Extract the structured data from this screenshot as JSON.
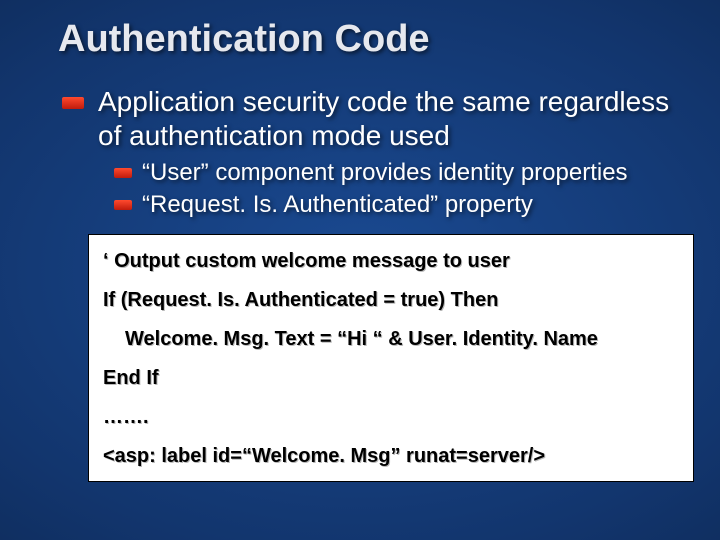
{
  "title": "Authentication Code",
  "main_bullet": "Application security code the same regardless of authentication mode used",
  "sub_bullets": [
    "“User” component provides identity properties",
    "“Request. Is. Authenticated” property"
  ],
  "code": {
    "l1": "‘ Output custom welcome message to user",
    "l2": "If (Request. Is. Authenticated = true) Then",
    "l3": "Welcome. Msg. Text = “Hi “ & User. Identity. Name",
    "l4": "End If",
    "l5": "…….",
    "l6": "<asp: label id=“Welcome. Msg” runat=server/>"
  }
}
